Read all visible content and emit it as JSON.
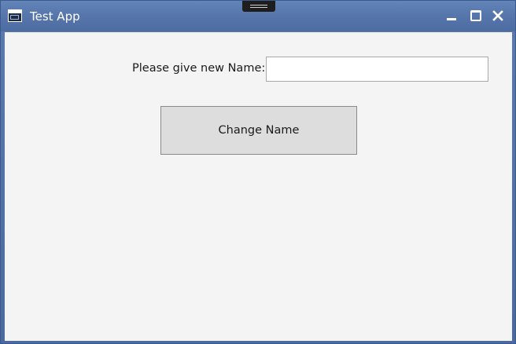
{
  "window": {
    "title": "Test App",
    "icons": {
      "app": "app-window-icon",
      "minimize": "minimize-icon",
      "maximize": "maximize-icon",
      "close": "close-icon",
      "grip": "drag-grip-icon"
    },
    "colors": {
      "titlebar": "#5676ab",
      "client_background": "#f4f4f4"
    }
  },
  "form": {
    "name_label": "Please give new Name:",
    "name_value": "",
    "change_button_label": "Change Name"
  }
}
